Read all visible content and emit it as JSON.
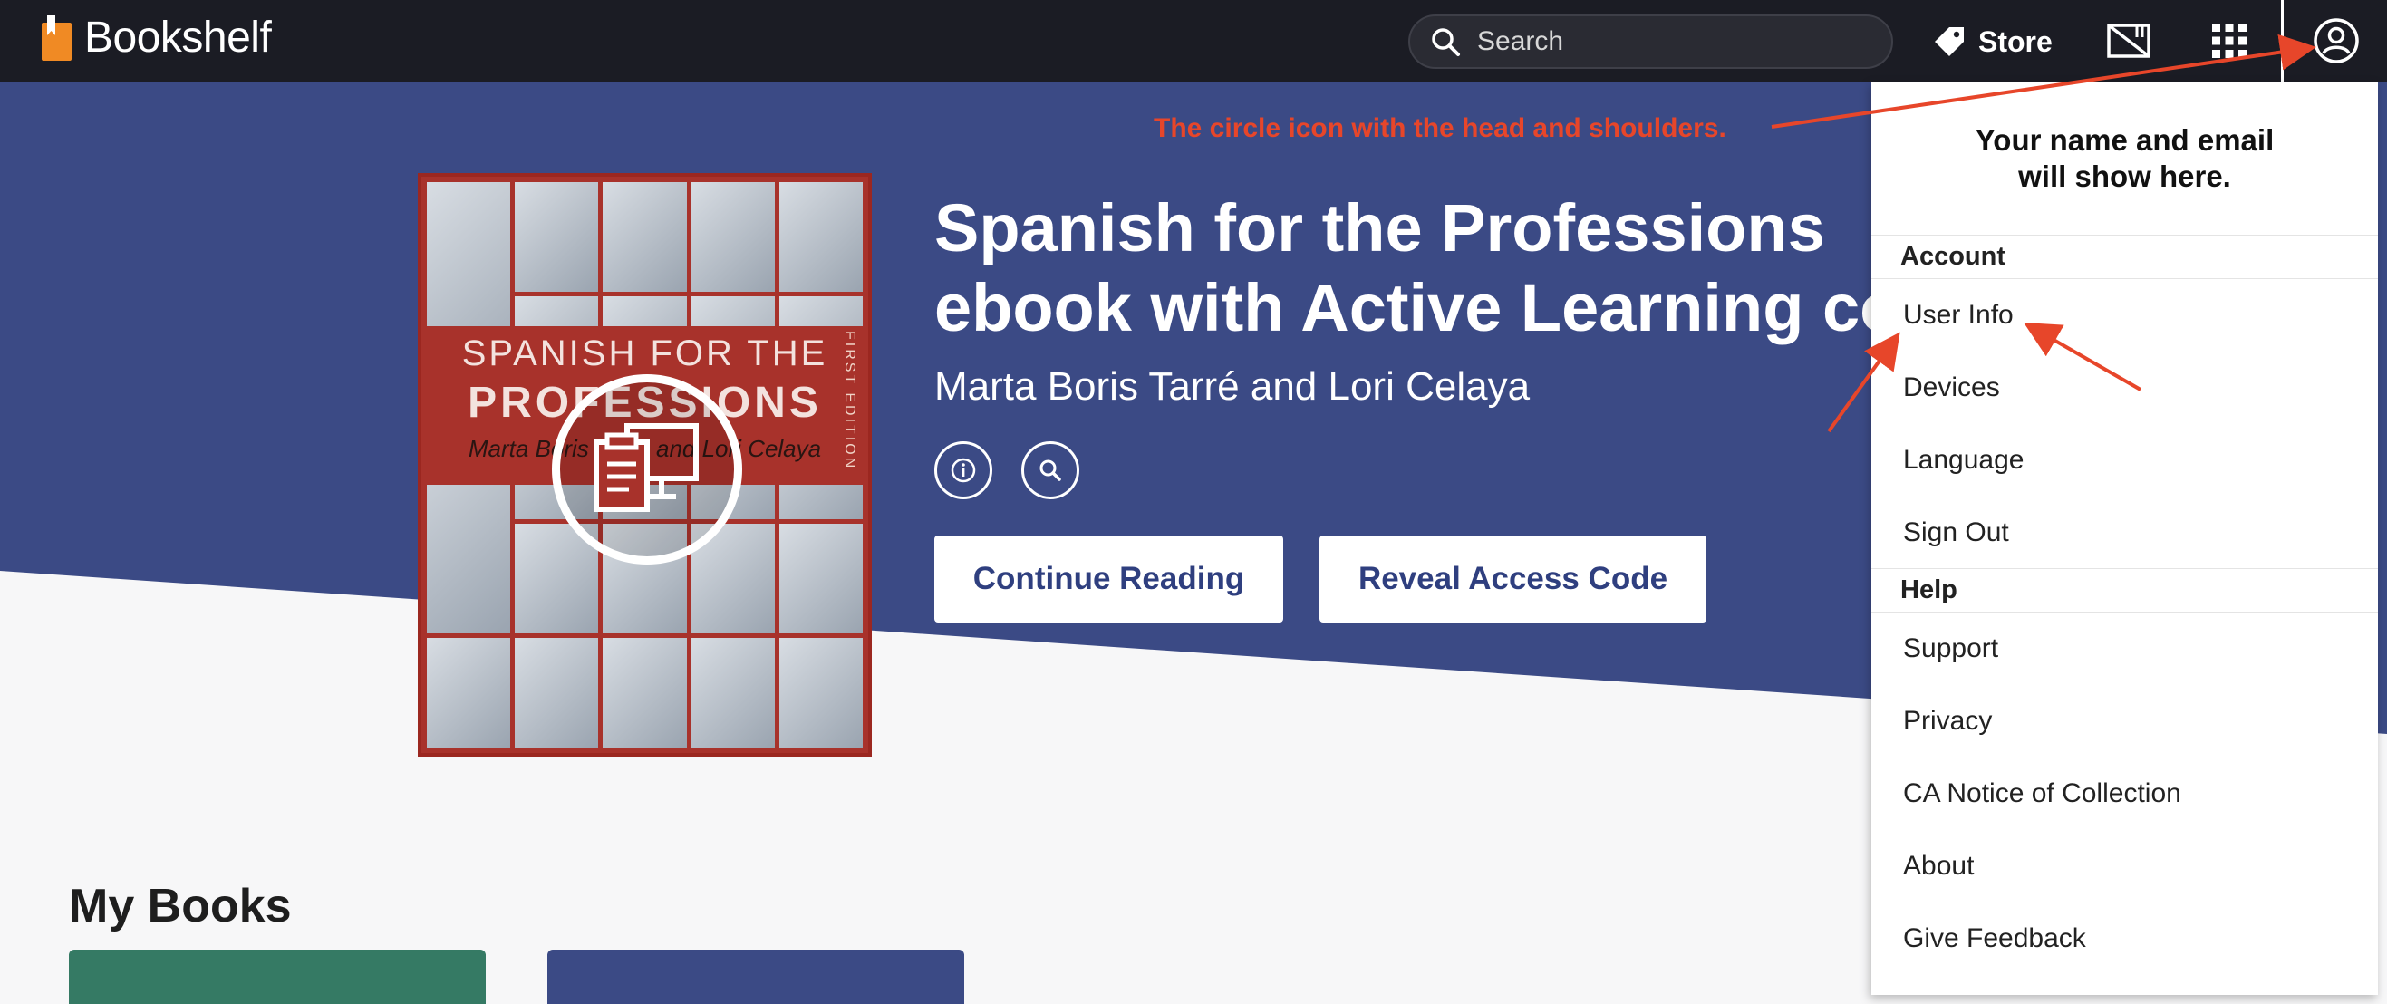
{
  "header": {
    "logo_text": "Bookshelf",
    "search_placeholder": "Search",
    "store_label": "Store"
  },
  "book": {
    "title": "Spanish for the Professions\nebook with Active Learning cou",
    "authors": "Marta Boris Tarré and Lori Celaya",
    "cover": {
      "line1": "SPANISH FOR THE",
      "line2": "PROFESSIONS",
      "line3": "Marta Boris Tarré and Lori Celaya",
      "edition": "FIRST EDITION"
    },
    "continue_label": "Continue Reading",
    "reveal_label": "Reveal Access Code"
  },
  "my_books_heading": "My Books",
  "annotation": "The circle icon with the head and shoulders.",
  "profile_menu": {
    "header_text": "Your name and email\nwill show here.",
    "account_section": "Account",
    "account_items": [
      "User Info",
      "Devices",
      "Language",
      "Sign Out"
    ],
    "help_section": "Help",
    "help_items": [
      "Support",
      "Privacy",
      "CA Notice of Collection",
      "About",
      "Give Feedback"
    ]
  },
  "colors": {
    "topbar": "#1b1c24",
    "hero": "#3b4a85",
    "accent_orange": "#f08a24",
    "annotation_red": "#e7462a",
    "tile_green": "#357a64",
    "tile_blue": "#3b4a85"
  },
  "icons": [
    "bookshelf-logo-icon",
    "search-icon",
    "tag-icon",
    "redeem-code-icon",
    "apps-grid-icon",
    "user-circle-icon",
    "info-icon",
    "magnify-icon",
    "digital-access-icon"
  ]
}
